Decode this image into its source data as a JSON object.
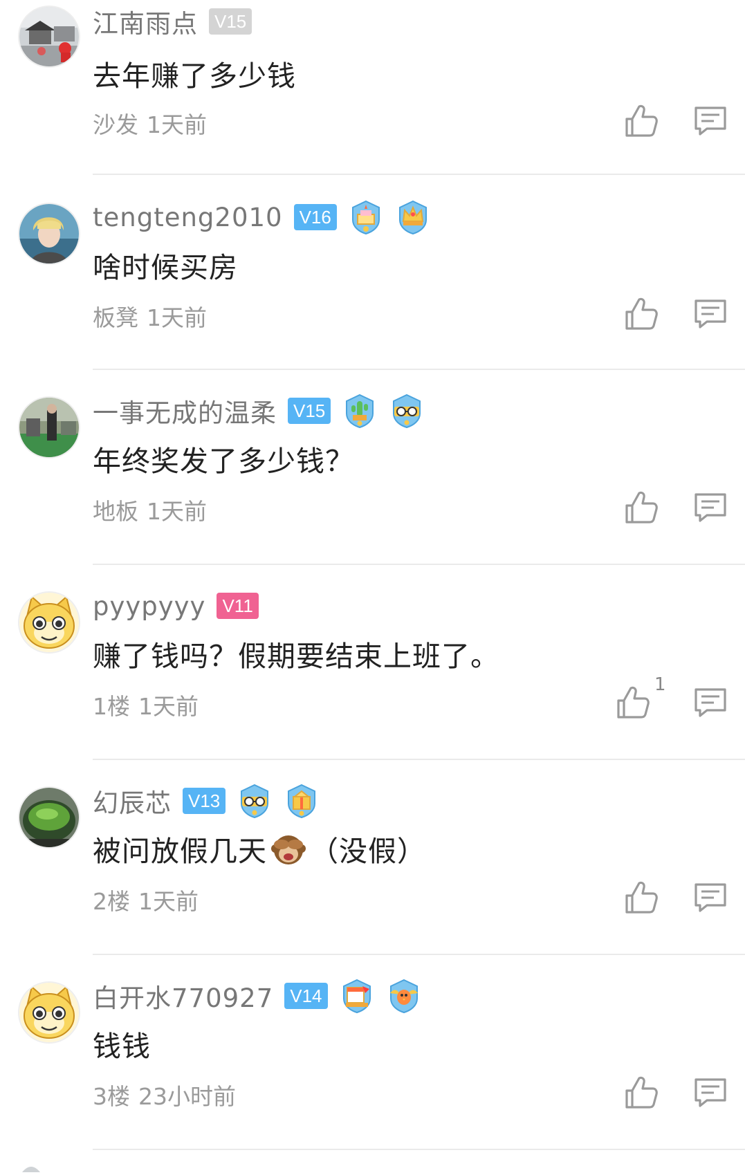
{
  "comments": [
    {
      "username": "江南雨点",
      "level": "V15",
      "level_color": "#d4d4d4",
      "avatar": "rainy-street-avatar",
      "medals": [],
      "text": "去年赚了多少钱",
      "floor": "沙发",
      "time": "1天前",
      "likes": ""
    },
    {
      "username": "tengteng2010",
      "level": "V16",
      "level_color": "#56b4f5",
      "avatar": "person-portrait-avatar",
      "medals": [
        "cake-medal",
        "crown-medal"
      ],
      "text": "啥时候买房",
      "floor": "板凳",
      "time": "1天前",
      "likes": ""
    },
    {
      "username": "一事无成的温柔",
      "level": "V15",
      "level_color": "#56b4f5",
      "avatar": "outdoor-event-avatar",
      "medals": [
        "cactus-medal",
        "glasses-medal"
      ],
      "text": "年终奖发了多少钱？",
      "floor": "地板",
      "time": "1天前",
      "likes": ""
    },
    {
      "username": "pyypyyy",
      "level": "V11",
      "level_color": "#f06292",
      "avatar": "cartoon-cat-avatar",
      "medals": [],
      "text": "赚了钱吗？假期要结束上班了。",
      "floor": "1楼",
      "time": "1天前",
      "likes": "1"
    },
    {
      "username": "幻辰芯",
      "level": "V13",
      "level_color": "#56b4f5",
      "avatar": "green-bowl-avatar",
      "medals": [
        "glasses-medal",
        "gift-medal"
      ],
      "text_before": "被问放假几天",
      "emoji": "see-no-evil-monkey-emoji",
      "text_after": "（没假）",
      "floor": "2楼",
      "time": "1天前",
      "likes": ""
    },
    {
      "username": "白开水770927",
      "level": "V14",
      "level_color": "#56b4f5",
      "avatar": "cartoon-cat-avatar",
      "medals": [
        "calendar-medal",
        "bird-medal"
      ],
      "text": "钱钱",
      "floor": "3楼",
      "time": "23小时前",
      "likes": ""
    }
  ],
  "colors": {
    "text_primary": "#222222",
    "text_secondary": "#777777",
    "meta": "#9a9a9a",
    "divider": "#eaeaea"
  }
}
